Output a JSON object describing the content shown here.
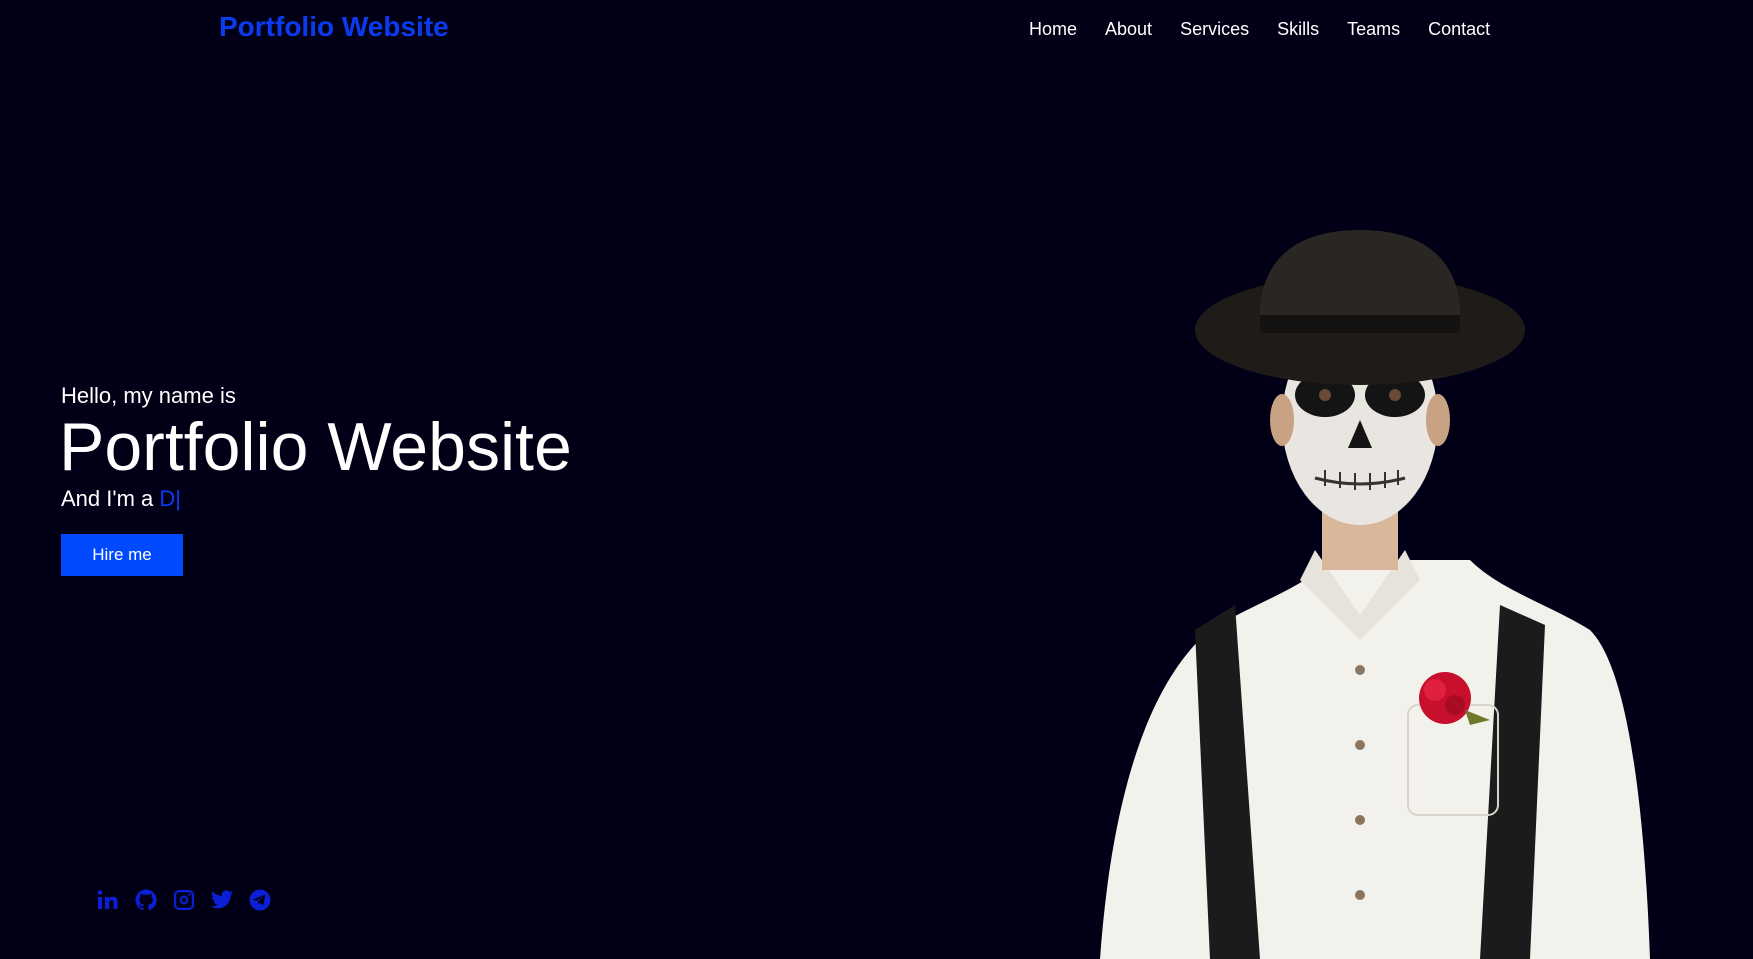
{
  "header": {
    "logo": "Portfolio Website",
    "nav": [
      "Home",
      "About",
      "Services",
      "Skills",
      "Teams",
      "Contact"
    ]
  },
  "hero": {
    "greeting": "Hello, my name is",
    "name": "Portfolio Website",
    "role_prefix": "And I'm a ",
    "role_typed": "D",
    "cursor": "|",
    "hire_label": "Hire me"
  },
  "socials": [
    "linkedin-icon",
    "github-icon",
    "instagram-icon",
    "twitter-icon",
    "telegram-icon"
  ],
  "colors": {
    "background": "#020016",
    "accent": "#0b3bf0",
    "button": "#0049ff"
  }
}
